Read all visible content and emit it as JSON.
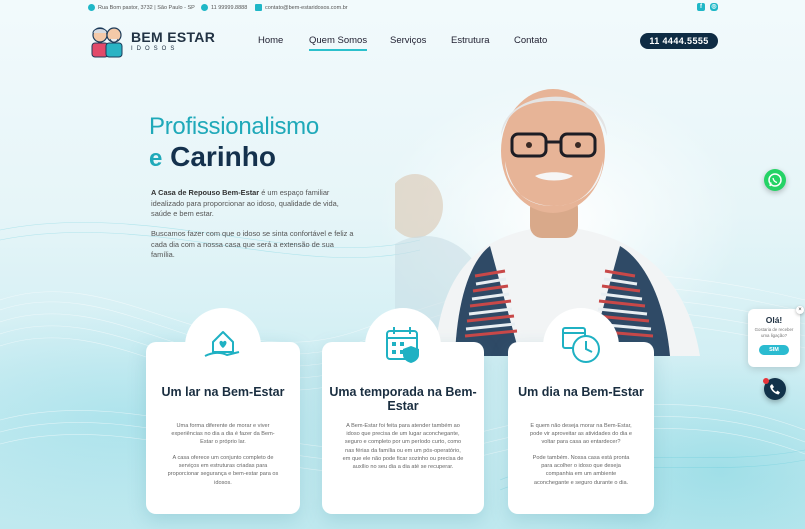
{
  "topbar": {
    "address": "Rua Bom pastor, 3732 | São Paulo - SP",
    "whatsapp": "11 99999.8888",
    "email": "contato@bem-estaridosos.com.br",
    "social": [
      "facebook-icon",
      "instagram-icon"
    ]
  },
  "brand": {
    "name": "BEM ESTAR",
    "sub": "IDOSOS"
  },
  "nav": {
    "items": [
      "Home",
      "Quem Somos",
      "Serviços",
      "Estrutura",
      "Contato"
    ],
    "active": "Quem Somos",
    "phone": "11 4444.5555"
  },
  "hero": {
    "title_line1": "Profissionalismo",
    "title_e": "e",
    "title_bold": "Carinho",
    "p1_bold": "A Casa de Repouso Bem-Estar",
    "p1_rest": " é um espaço familiar idealizado para proporcionar ao idoso, qualidade de vida, saúde e bem estar.",
    "p2": "Buscamos fazer com que o idoso se sinta confortável e feliz a cada dia com a nossa casa que será a extensão de sua família."
  },
  "cards": [
    {
      "title": "Um lar na Bem-Estar",
      "p1": "Uma forma diferente de morar e viver experiências no dia a dia é fazer da Bem-Estar o próprio lar.",
      "p2": "A casa oferece um conjunto completo de serviços em estruturas criadas para proporcionar segurança e bem-estar para os idosos."
    },
    {
      "title": "Uma temporada na Bem-Estar",
      "p1": "A Bem-Estar foi feita para atender também ao idoso que precisa de um lugar aconchegante, seguro e completo por um período curto, como nas férias da família ou em um pós-operatório, em que ele não pode ficar sozinho ou precisa de auxílio no seu dia a dia até se recuperar."
    },
    {
      "title": "Um dia na Bem-Estar",
      "p1": "E quem não deseja morar na Bem-Estar, pode vir aproveitar as atividades do dia e voltar para casa ao entardecer?",
      "p2": "Pode também. Nossa casa está pronta para acolher o idoso que deseja companhia em um ambiente aconchegante e seguro durante o dia."
    }
  ],
  "chat": {
    "hello": "Olá!",
    "question": "Gostaria de receber uma ligação?",
    "yes": "SIM",
    "close": "×"
  },
  "colors": {
    "accent": "#1fa9b9",
    "dark": "#14314d",
    "whatsapp": "#25d366"
  }
}
